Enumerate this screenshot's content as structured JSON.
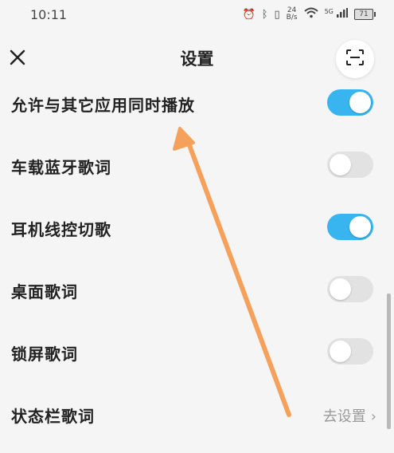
{
  "status_bar": {
    "time": "10:11",
    "net_speed_value": "24",
    "net_speed_unit": "B/s",
    "signal_label": "5G",
    "battery": "71"
  },
  "header": {
    "title": "设置",
    "close_icon": "close-icon",
    "scan_icon": "scan-icon"
  },
  "settings": [
    {
      "label": "允许与其它应用同时播放",
      "type": "toggle",
      "on": true
    },
    {
      "label": "车载蓝牙歌词",
      "type": "toggle",
      "on": false
    },
    {
      "label": "耳机线控切歌",
      "type": "toggle",
      "on": true
    },
    {
      "label": "桌面歌词",
      "type": "toggle",
      "on": false
    },
    {
      "label": "锁屏歌词",
      "type": "toggle",
      "on": false
    },
    {
      "label": "状态栏歌词",
      "type": "link",
      "link_text": "去设置"
    }
  ],
  "colors": {
    "toggle_on": "#38b4ef",
    "toggle_off": "#e2e2e2",
    "annotation_arrow": "#f5a15b"
  }
}
